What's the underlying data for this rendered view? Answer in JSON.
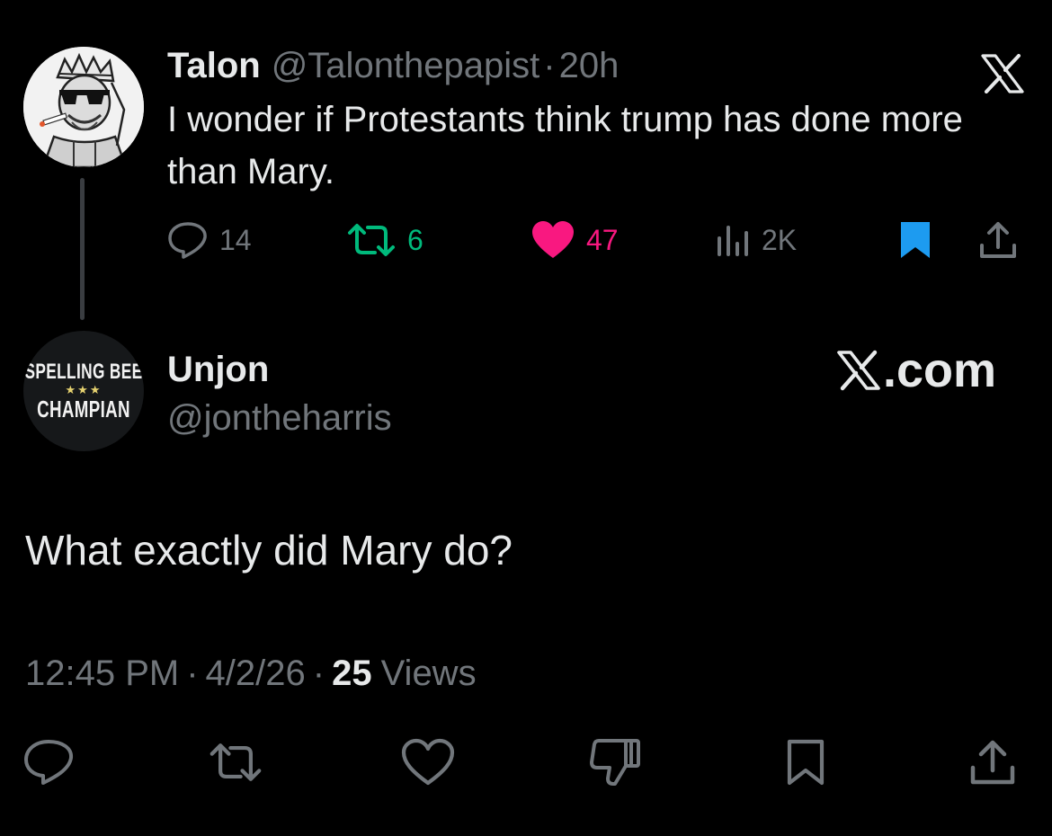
{
  "parent_tweet": {
    "author_name": "Talon",
    "handle": "@Talonthepapist",
    "separator": "·",
    "time": "20h",
    "text": "I wonder if Protestants think trump has done more than Mary.",
    "actions": {
      "reply": {
        "icon": "reply-icon",
        "count": "14"
      },
      "retweet": {
        "icon": "retweet-icon",
        "count": "6",
        "color": "#00ba7c"
      },
      "like": {
        "icon": "heart-filled-icon",
        "count": "47",
        "color": "#f91880"
      },
      "views": {
        "icon": "views-bar-chart-icon",
        "count": "2K"
      },
      "bookmark": {
        "icon": "bookmark-filled-icon",
        "color": "#1d9bf0"
      },
      "share": {
        "icon": "share-icon"
      }
    },
    "close_icon": "x-logo-icon"
  },
  "reply_tweet": {
    "author_name": "Unjon",
    "handle": "@jontheharris",
    "avatar": {
      "top_text": "SPELLING BEE",
      "stars": "★★★",
      "bottom_text": "CHAMPIAN"
    },
    "source_badge": ".com",
    "text": "What exactly did Mary do?",
    "meta": {
      "time": "12:45 PM",
      "separator": "·",
      "date": "4/2/26",
      "views_count": "25",
      "views_label": "Views"
    },
    "actions": [
      "reply-icon",
      "retweet-icon",
      "heart-outline-icon",
      "dislike-icon",
      "bookmark-outline-icon",
      "share-icon"
    ]
  },
  "colors": {
    "background": "#000000",
    "text_primary": "#e7e9ea",
    "text_secondary": "#71767b",
    "retweet": "#00ba7c",
    "like": "#f91880",
    "bookmark": "#1d9bf0"
  }
}
